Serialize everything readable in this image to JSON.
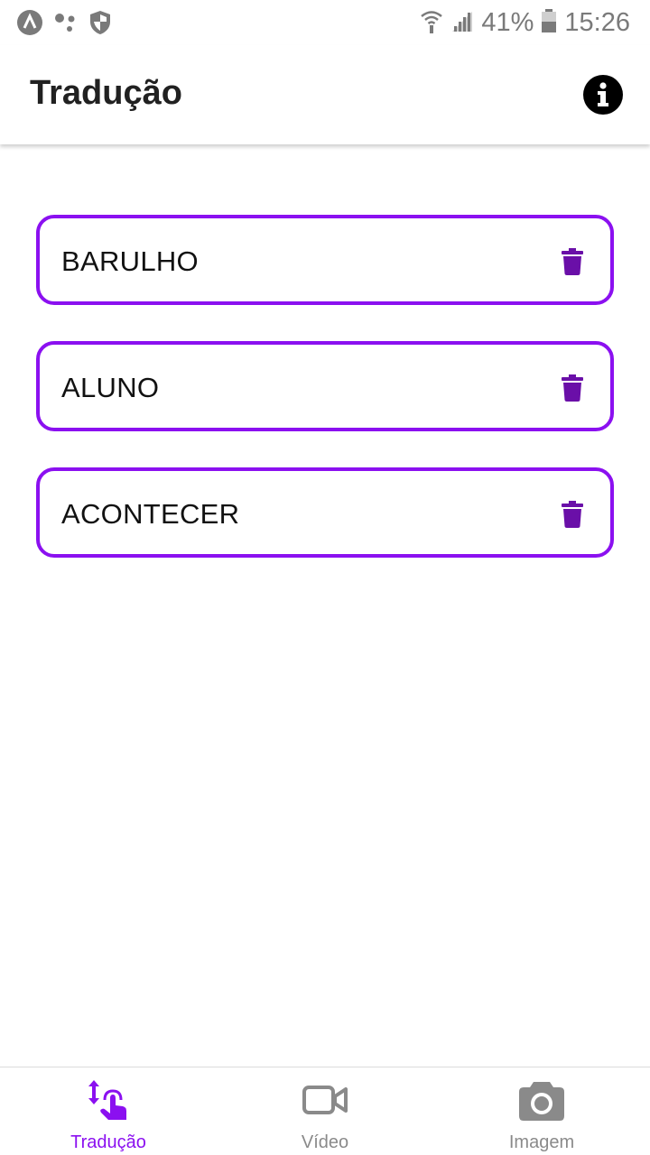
{
  "status_bar": {
    "battery": "41%",
    "time": "15:26"
  },
  "app_bar": {
    "title": "Tradução"
  },
  "words": [
    {
      "label": "BARULHO"
    },
    {
      "label": "ALUNO"
    },
    {
      "label": "ACONTECER"
    }
  ],
  "bottom_nav": {
    "items": [
      {
        "label": "Tradução",
        "icon": "touch-swipe-icon",
        "active": true
      },
      {
        "label": "Vídeo",
        "icon": "video-camera-icon",
        "active": false
      },
      {
        "label": "Imagem",
        "icon": "photo-camera-icon",
        "active": false
      }
    ]
  },
  "colors": {
    "accent": "#8b10f0",
    "delete_icon": "#6a0fa8",
    "inactive": "#8a8a8a"
  }
}
